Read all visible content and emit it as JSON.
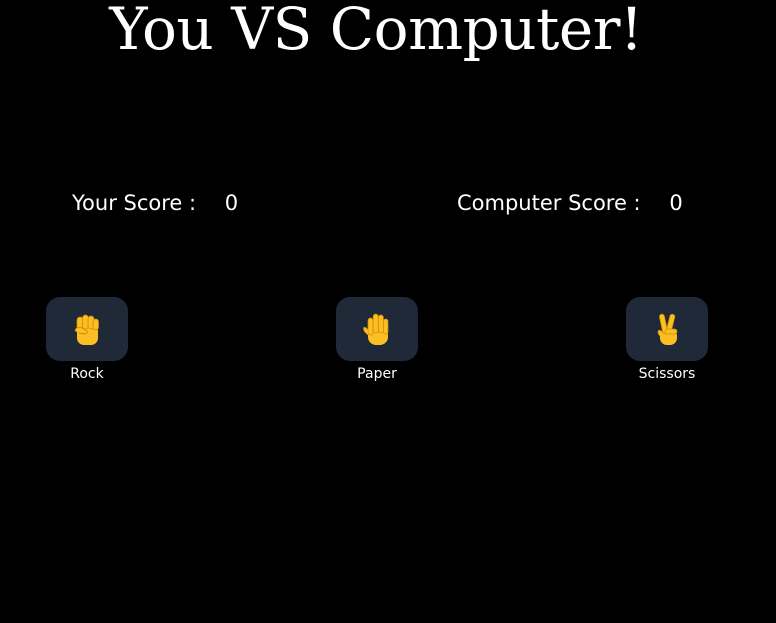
{
  "title": "You VS Computer!",
  "scores": {
    "player_label": "Your Score :",
    "player_value": "0",
    "computer_label": "Computer Score :",
    "computer_value": "0"
  },
  "choices": [
    {
      "label": "Rock",
      "icon": "raised-fist-icon"
    },
    {
      "label": "Paper",
      "icon": "raised-hand-icon"
    },
    {
      "label": "Scissors",
      "icon": "victory-hand-icon"
    }
  ],
  "colors": {
    "background": "#000000",
    "button_bg": "#1f2937",
    "text": "#ffffff",
    "emoji_skin": "#fbbf24"
  }
}
